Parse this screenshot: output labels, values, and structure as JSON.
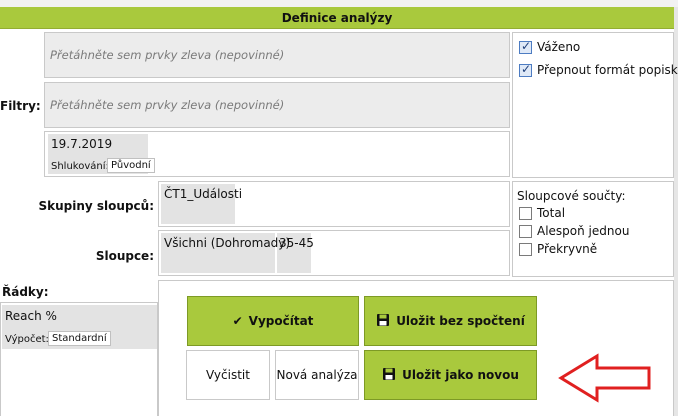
{
  "header": {
    "title": "Definice analýzy"
  },
  "filters": {
    "label": "Filtry:",
    "placeholder1": "Přetáhněte sem prvky zleva (nepovinné)",
    "placeholder2": "Přetáhněte sem prvky zleva (nepovinné)",
    "date_value": "19.7.2019",
    "clustering_label": "Shlukování:",
    "clustering_value": "Původní"
  },
  "options": {
    "weighted_label": "Váženo",
    "weighted_checked": true,
    "switch_format_label": "Přepnout formát popisků",
    "switch_format_checked": true
  },
  "column_groups": {
    "label": "Skupiny sloupců:",
    "value": "ČT1_Události"
  },
  "columns": {
    "label": "Sloupce:",
    "value1": "Všichni (Dohromady)",
    "value2": "35-45"
  },
  "column_totals": {
    "title": "Sloupcové součty:",
    "items": [
      {
        "label": "Total",
        "checked": false
      },
      {
        "label": "Alespoň jednou",
        "checked": false
      },
      {
        "label": "Překryvně",
        "checked": false
      }
    ]
  },
  "rows": {
    "label": "Řádky:",
    "value": "Reach %",
    "calc_label": "Výpočet:",
    "calc_value": "Standardní"
  },
  "buttons": {
    "calculate": "Vypočítat",
    "save_no_calc": "Uložit bez spočtení",
    "clear": "Vyčistit",
    "new_analysis": "Nová analýza",
    "save_as_new": "Uložit jako novou"
  },
  "colors": {
    "accent": "#a9c93d",
    "arrow": "#e02020"
  }
}
